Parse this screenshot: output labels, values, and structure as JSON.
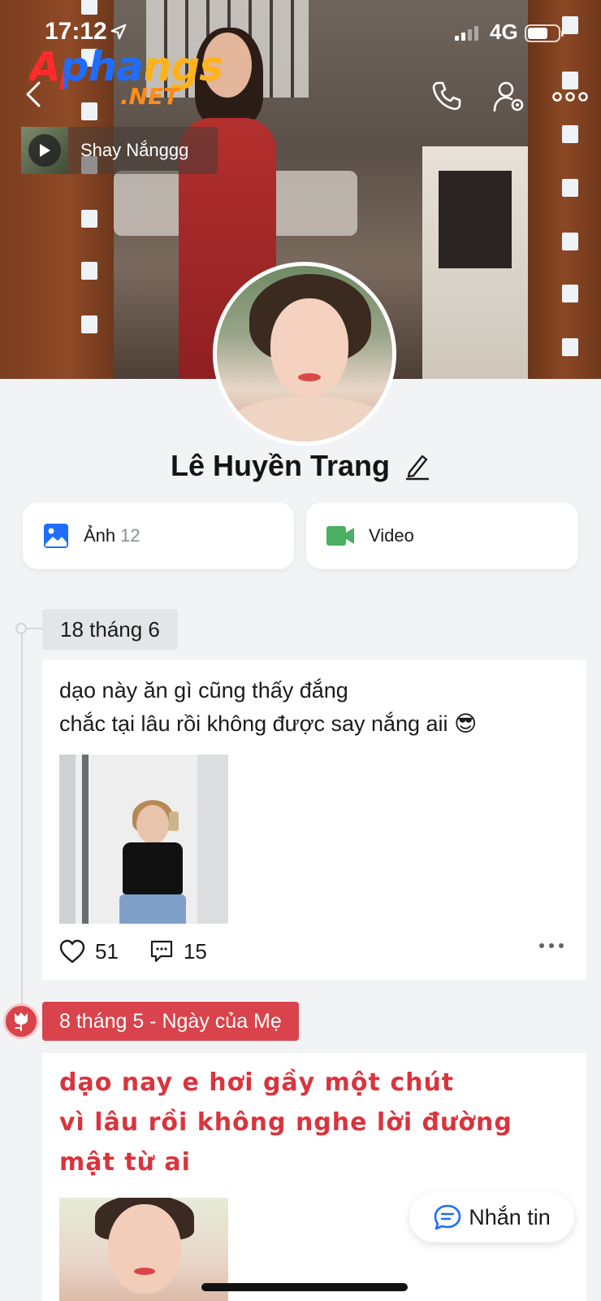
{
  "status_bar": {
    "time": "17:12",
    "network": "4G"
  },
  "watermark": {
    "main": "Aphangs",
    "suffix": ".NET"
  },
  "music": {
    "song_title": "Shay Nắnggg"
  },
  "profile": {
    "name": "Lê Huyền Trang"
  },
  "media": {
    "photos_label": "Ảnh",
    "photos_count": "12",
    "videos_label": "Video"
  },
  "timeline": {
    "posts": [
      {
        "date": "18 tháng 6",
        "text_line1": "dạo này ăn gì cũng thấy đắng",
        "text_line2": "chắc tại lâu rồi không được say nắng aii",
        "emoji": "😎",
        "likes": "51",
        "comments": "15"
      },
      {
        "date": "8 tháng 5 - Ngày của Mẹ",
        "text_line1": "dạo nay e hơi gầy một chút",
        "text_line2": "vì lâu rồi không nghe lời đường mật từ ai"
      }
    ]
  },
  "message_button": {
    "label": "Nhắn tin"
  },
  "colors": {
    "accent_blue": "#1e6dff",
    "holiday_red": "#d9434b",
    "video_green": "#4caf63"
  },
  "icons": [
    "back-chevron-icon",
    "phone-icon",
    "user-settings-icon",
    "more-horizontal-icon",
    "play-icon",
    "edit-pencil-icon",
    "photo-icon",
    "video-camera-icon",
    "heart-icon",
    "comment-icon",
    "tulip-icon",
    "chat-bubble-icon"
  ]
}
